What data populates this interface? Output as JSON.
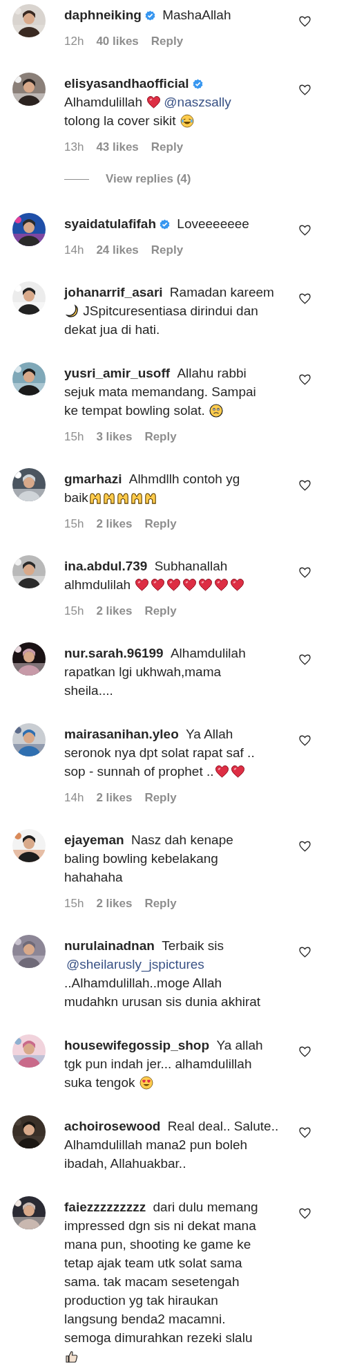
{
  "comments": [
    {
      "username": "daphneiking",
      "verified": true,
      "lines": [
        [
          {
            "kind": "text",
            "text": "MashaAllah"
          }
        ]
      ],
      "meta": {
        "time": "12h",
        "likes": "40 likes",
        "reply": "Reply"
      }
    },
    {
      "username": "elisyasandhaofficial",
      "verified": true,
      "break_after_name": true,
      "lines": [
        [
          {
            "kind": "text",
            "text": "Alhamdulillah "
          },
          {
            "kind": "heart"
          },
          {
            "kind": "mention",
            "text": "@naszsally"
          }
        ],
        [
          {
            "kind": "text",
            "text": "tolong la cover sikit "
          },
          {
            "kind": "laugh"
          }
        ]
      ],
      "meta": {
        "time": "13h",
        "likes": "43 likes",
        "reply": "Reply"
      },
      "view_replies": "View replies (4)"
    },
    {
      "username": "syaidatulafifah",
      "verified": true,
      "lines": [
        [
          {
            "kind": "text",
            "text": "Loveeeeeee"
          }
        ]
      ],
      "meta": {
        "time": "14h",
        "likes": "24 likes",
        "reply": "Reply"
      }
    },
    {
      "username": "johanarrif_asari",
      "verified": false,
      "lines": [
        [
          {
            "kind": "text",
            "text": "Ramadan kareem"
          }
        ],
        [
          {
            "kind": "moon"
          },
          {
            "kind": "text",
            "text": " JSpitcuresentiasa dirindui dan"
          }
        ],
        [
          {
            "kind": "text",
            "text": "dekat jua di hati."
          }
        ]
      ]
    },
    {
      "username": "yusri_amir_usoff",
      "verified": false,
      "lines": [
        [
          {
            "kind": "text",
            "text": "Allahu rabbi"
          }
        ],
        [
          {
            "kind": "text",
            "text": "sejuk mata memandang. Sampai"
          }
        ],
        [
          {
            "kind": "text",
            "text": "ke tempat bowling solat. "
          },
          {
            "kind": "sad"
          }
        ]
      ],
      "meta": {
        "time": "15h",
        "likes": "3 likes",
        "reply": "Reply"
      }
    },
    {
      "username": "gmarhazi",
      "verified": false,
      "lines": [
        [
          {
            "kind": "text",
            "text": "Alhmdllh contoh yg"
          }
        ],
        [
          {
            "kind": "text",
            "text": "baik"
          },
          {
            "kind": "hands"
          },
          {
            "kind": "hands"
          },
          {
            "kind": "hands"
          },
          {
            "kind": "hands"
          },
          {
            "kind": "hands"
          }
        ]
      ],
      "meta": {
        "time": "15h",
        "likes": "2 likes",
        "reply": "Reply"
      }
    },
    {
      "username": "ina.abdul.739",
      "verified": false,
      "lines": [
        [
          {
            "kind": "text",
            "text": "Subhanallah"
          }
        ],
        [
          {
            "kind": "text",
            "text": "alhmdulilah "
          },
          {
            "kind": "heart"
          },
          {
            "kind": "heart"
          },
          {
            "kind": "heart"
          },
          {
            "kind": "heart"
          },
          {
            "kind": "heart"
          },
          {
            "kind": "heart"
          },
          {
            "kind": "heart"
          }
        ]
      ],
      "meta": {
        "time": "15h",
        "likes": "2 likes",
        "reply": "Reply"
      }
    },
    {
      "username": "nur.sarah.96199",
      "verified": false,
      "lines": [
        [
          {
            "kind": "text",
            "text": "Alhamdulilah"
          }
        ],
        [
          {
            "kind": "text",
            "text": "rapatkan lgi ukhwah,mama"
          }
        ],
        [
          {
            "kind": "text",
            "text": "sheila...."
          }
        ]
      ]
    },
    {
      "username": "mairasanihan.yleo",
      "verified": false,
      "lines": [
        [
          {
            "kind": "text",
            "text": "Ya Allah"
          }
        ],
        [
          {
            "kind": "text",
            "text": "seronok nya dpt solat rapat saf .."
          }
        ],
        [
          {
            "kind": "text",
            "text": "sop - sunnah of prophet .."
          },
          {
            "kind": "heart"
          },
          {
            "kind": "heart"
          }
        ]
      ],
      "meta": {
        "time": "14h",
        "likes": "2 likes",
        "reply": "Reply"
      }
    },
    {
      "username": "ejayeman",
      "verified": false,
      "lines": [
        [
          {
            "kind": "text",
            "text": "Nasz dah kenape"
          }
        ],
        [
          {
            "kind": "text",
            "text": "baling bowling kebelakang"
          }
        ],
        [
          {
            "kind": "text",
            "text": "hahahaha"
          }
        ]
      ],
      "meta": {
        "time": "15h",
        "likes": "2 likes",
        "reply": "Reply"
      }
    },
    {
      "username": "nurulainadnan",
      "verified": false,
      "lines": [
        [
          {
            "kind": "text",
            "text": "Terbaik sis"
          }
        ],
        [
          {
            "kind": "mention",
            "text": "@sheilarusly_jspictures"
          }
        ],
        [
          {
            "kind": "text",
            "text": "..Alhamdulillah..moge Allah"
          }
        ],
        [
          {
            "kind": "text",
            "text": "mudahkn urusan sis dunia akhirat"
          }
        ]
      ]
    },
    {
      "username": "housewifegossip_shop",
      "verified": false,
      "lines": [
        [
          {
            "kind": "text",
            "text": "Ya allah"
          }
        ],
        [
          {
            "kind": "text",
            "text": "tgk pun indah jer... alhamdulillah"
          }
        ],
        [
          {
            "kind": "text",
            "text": "suka tengok "
          },
          {
            "kind": "hearteyes"
          }
        ]
      ]
    },
    {
      "username": "achoirosewood",
      "verified": false,
      "lines": [
        [
          {
            "kind": "text",
            "text": "Real deal.. Salute.."
          }
        ],
        [
          {
            "kind": "text",
            "text": "Alhamdulillah mana2 pun boleh"
          }
        ],
        [
          {
            "kind": "text",
            "text": "ibadah, Allahuakbar.."
          }
        ]
      ]
    },
    {
      "username": "faiezzzzzzzzz",
      "verified": false,
      "lines": [
        [
          {
            "kind": "text",
            "text": "dari dulu memang"
          }
        ],
        [
          {
            "kind": "text",
            "text": "impressed dgn sis ni dekat mana"
          }
        ],
        [
          {
            "kind": "text",
            "text": "mana pun, shooting ke game ke"
          }
        ],
        [
          {
            "kind": "text",
            "text": "tetap ajak team utk solat sama"
          }
        ],
        [
          {
            "kind": "text",
            "text": "sama. tak macam sesetengah"
          }
        ],
        [
          {
            "kind": "text",
            "text": "production yg tak hiraukan"
          }
        ],
        [
          {
            "kind": "text",
            "text": "langsung benda2 macamni."
          }
        ],
        [
          {
            "kind": "text",
            "text": "semoga dimurahkan rezeki slalu"
          }
        ],
        [
          {
            "kind": "thumbs"
          }
        ]
      ]
    }
  ]
}
